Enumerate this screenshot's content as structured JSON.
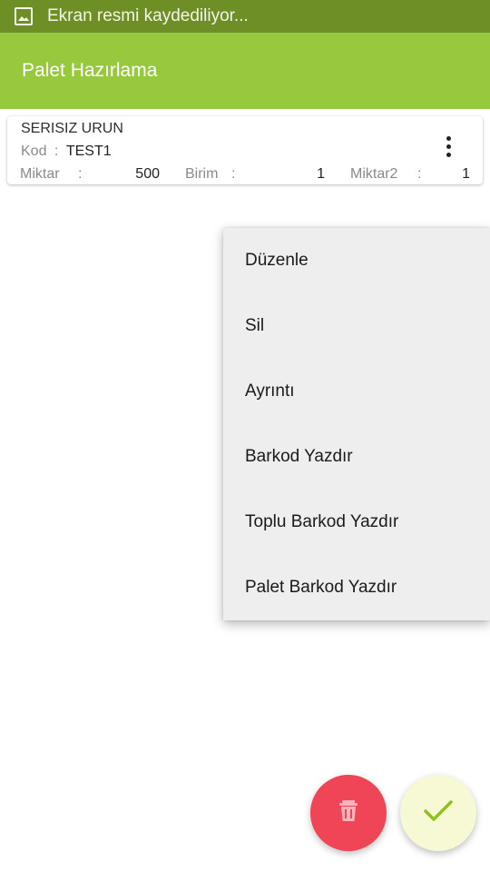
{
  "status_bar": {
    "text": "Ekran resmi kaydediliyor...",
    "icon": "screenshot-icon"
  },
  "app_bar": {
    "title": "Palet Hazırlama"
  },
  "item_card": {
    "title": "SERISIZ URUN",
    "kod_label": "Kod",
    "kod_sep": ":",
    "kod_value": "TEST1",
    "miktar_label": "Miktar",
    "miktar_sep": ":",
    "miktar_value": "500",
    "birim_label": "Birim",
    "birim_sep": ":",
    "birim_value": "1",
    "miktar2_label": "Miktar2",
    "miktar2_sep": ":",
    "miktar2_value": "1",
    "more_icon": "more-vert-icon"
  },
  "context_menu": {
    "items": [
      {
        "label": "Düzenle"
      },
      {
        "label": "Sil"
      },
      {
        "label": "Ayrıntı"
      },
      {
        "label": "Barkod Yazdır"
      },
      {
        "label": "Toplu Barkod Yazdır"
      },
      {
        "label": "Palet Barkod Yazdır"
      }
    ]
  },
  "fabs": {
    "delete_icon": "trash-icon",
    "confirm_icon": "checkmark-icon"
  },
  "colors": {
    "status_bar": "#6e8f25",
    "app_bar": "#96c93d",
    "delete_fab": "#ef4556",
    "confirm_fab": "#f7f8d4",
    "checkmark": "#8dc21f",
    "menu_bg": "#eeeeee"
  }
}
